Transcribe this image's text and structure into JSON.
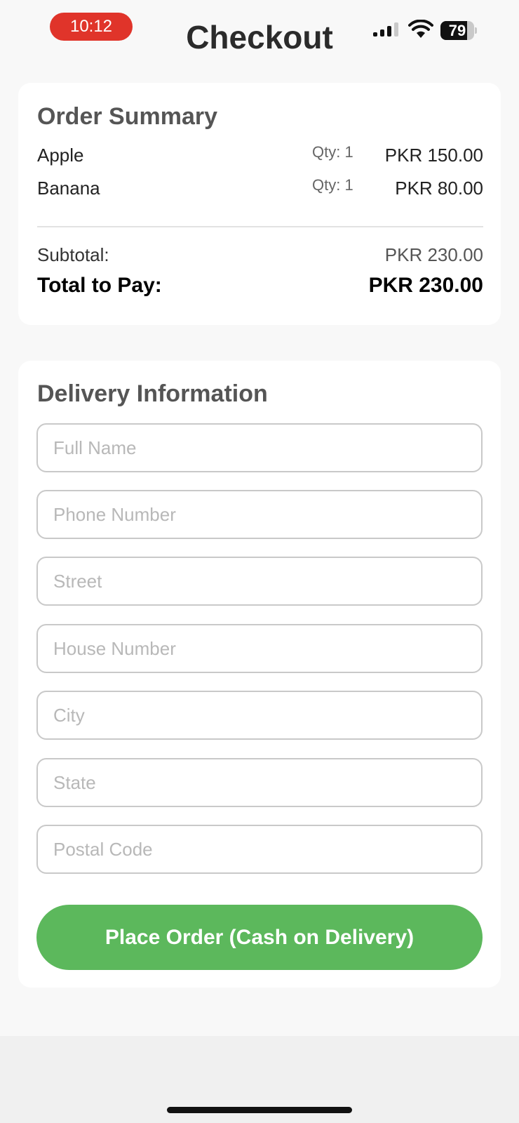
{
  "status_bar": {
    "time": "10:12",
    "battery_level": "79",
    "battery_fraction": 0.79,
    "time_pill_color": "#e0342a",
    "icons": [
      "cellular-signal-icon",
      "wifi-icon",
      "battery-icon"
    ]
  },
  "header": {
    "title": "Checkout"
  },
  "order_summary": {
    "title": "Order Summary",
    "items": [
      {
        "name": "Apple",
        "qty": "Qty: 1",
        "price": "PKR 150.00"
      },
      {
        "name": "Banana",
        "qty": "Qty: 1",
        "price": "PKR 80.00"
      }
    ],
    "subtotal_label": "Subtotal:",
    "subtotal_value": "PKR 230.00",
    "total_label": "Total to Pay:",
    "total_value": "PKR 230.00"
  },
  "delivery": {
    "title": "Delivery Information",
    "fields": [
      {
        "placeholder": "Full Name",
        "value": ""
      },
      {
        "placeholder": "Phone Number",
        "value": ""
      },
      {
        "placeholder": "Street",
        "value": ""
      },
      {
        "placeholder": "House Number",
        "value": ""
      },
      {
        "placeholder": "City",
        "value": ""
      },
      {
        "placeholder": "State",
        "value": ""
      },
      {
        "placeholder": "Postal Code",
        "value": ""
      }
    ],
    "submit_label": "Place Order (Cash on Delivery)",
    "submit_color": "#5cb85c"
  }
}
